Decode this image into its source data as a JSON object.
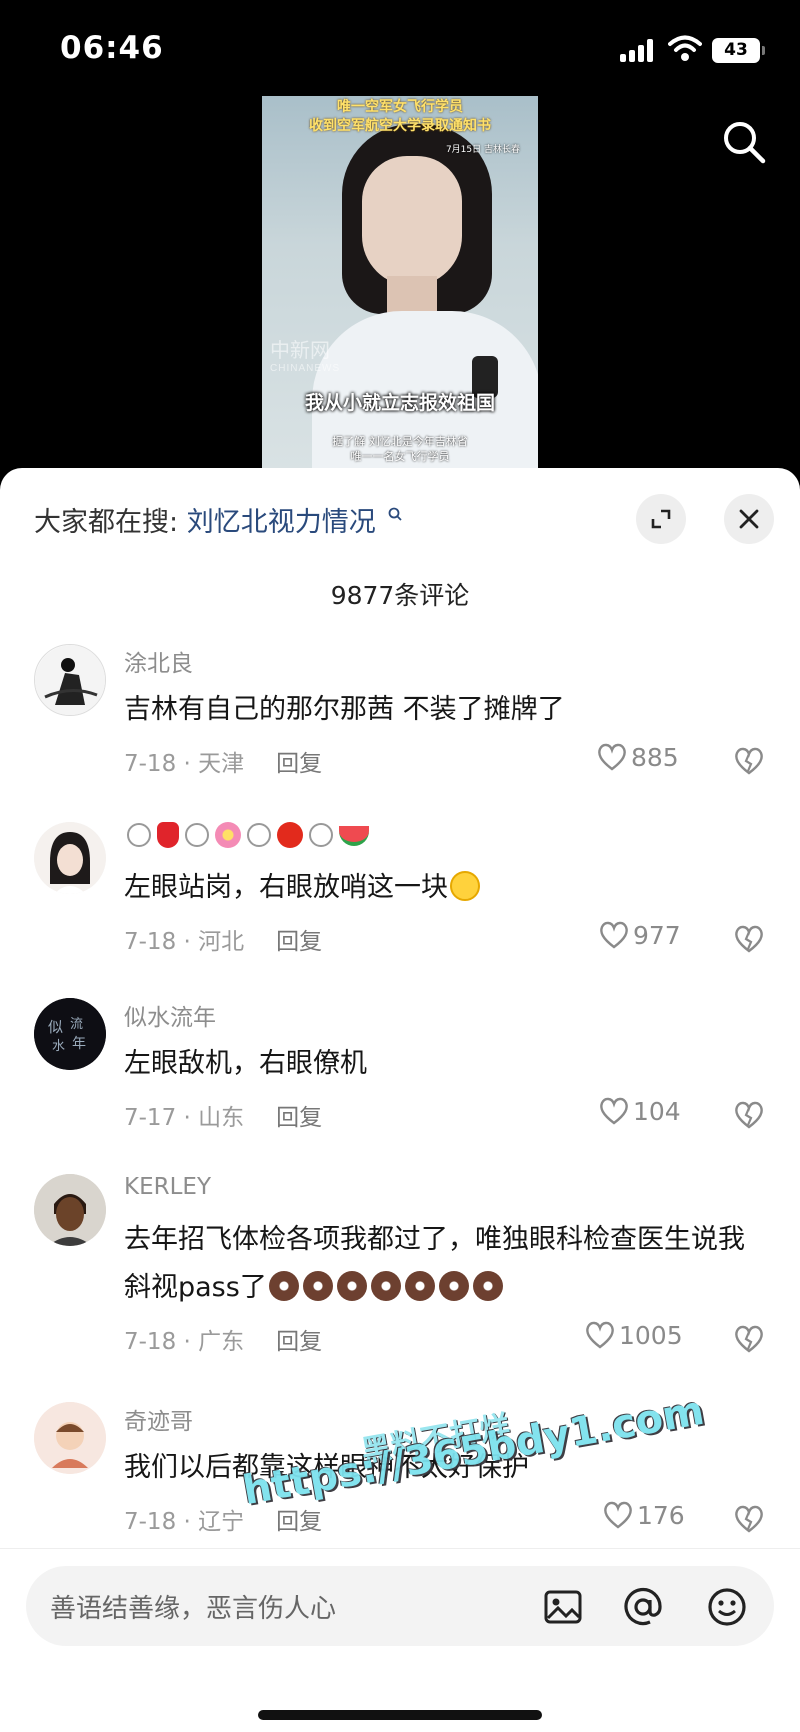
{
  "status_bar": {
    "time": "06:46",
    "battery": "43"
  },
  "video": {
    "title_line1": "唯一空军女飞行学员",
    "title_line2": "收到空军航空大学录取通知书",
    "date": "7月15日 吉林长春",
    "watermark": "中新网",
    "watermark_en": "CHINANEWS",
    "subtitle": "我从小就立志报效祖国",
    "caption_line1": "据了解 刘忆北是今年吉林省",
    "caption_line2": "唯一一名女飞行学员"
  },
  "sheet": {
    "trend_prefix": "大家都在搜:",
    "trend_term": "刘忆北视力情况",
    "comment_count": "9877条评论"
  },
  "comments": [
    {
      "user": "涂北良",
      "text": "吉林有自己的那尔那茜  不装了摊牌了",
      "meta": "7-18 · 天津",
      "reply": "回复",
      "likes": "885"
    },
    {
      "user": "",
      "text": "左眼站岗，右眼放哨这一块",
      "meta": "7-18 · 河北",
      "reply": "回复",
      "likes": "977"
    },
    {
      "user": "似水流年",
      "text": "左眼敌机，右眼僚机",
      "meta": "7-17 · 山东",
      "reply": "回复",
      "likes": "104"
    },
    {
      "user": "KERLEY",
      "text": "去年招飞体检各项我都过了，唯独眼科检查医生说我斜视pass了",
      "meta": "7-18 · 广东",
      "reply": "回复",
      "likes": "1005"
    },
    {
      "user": "奇迹哥",
      "text": "我们以后都靠这样眼神不太好保护",
      "meta": "7-18 · 辽宁",
      "reply": "回复",
      "likes": "176"
    }
  ],
  "overlay_watermark": {
    "line1": "黑料不打烊",
    "line2": "https://365bdy1.com"
  },
  "input": {
    "placeholder": "善语结善缘，恶言伤人心"
  }
}
